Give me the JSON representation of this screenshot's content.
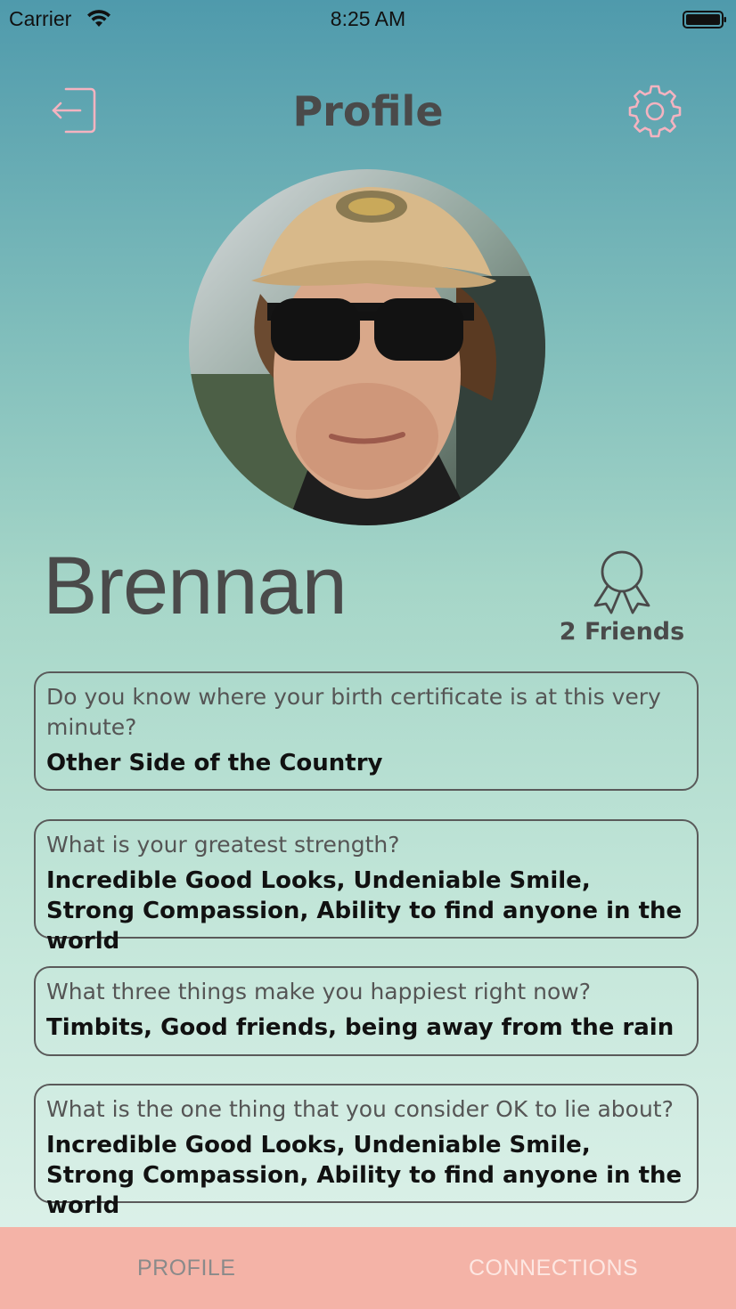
{
  "status": {
    "carrier": "Carrier",
    "time": "8:25 AM"
  },
  "header": {
    "title": "Profile"
  },
  "profile": {
    "name": "Brennan",
    "friends_label": "2 Friends"
  },
  "questions": [
    {
      "question": "Do you know where your birth certificate is at this very minute?",
      "answer": "Other Side of the Country"
    },
    {
      "question": "What is your greatest strength?",
      "answer": "Incredible Good Looks, Undeniable Smile, Strong Compassion, Ability to find anyone in the world"
    },
    {
      "question": "What three things make you happiest right now?",
      "answer": "Timbits, Good friends, being away from the rain"
    },
    {
      "question": "What is the one thing that you consider OK to lie about?",
      "answer": "Incredible Good Looks, Undeniable Smile, Strong Compassion, Ability to find anyone in the world"
    }
  ],
  "tabs": {
    "profile": "PROFILE",
    "connections": "CONNECTIONS"
  },
  "colors": {
    "tabbar": "#f4b3a7",
    "icon_accent": "#f4b3c0",
    "text": "#4a4a4a"
  },
  "icons": {
    "logout": "logout-icon",
    "settings": "gear-icon",
    "badge": "award-ribbon-icon"
  }
}
